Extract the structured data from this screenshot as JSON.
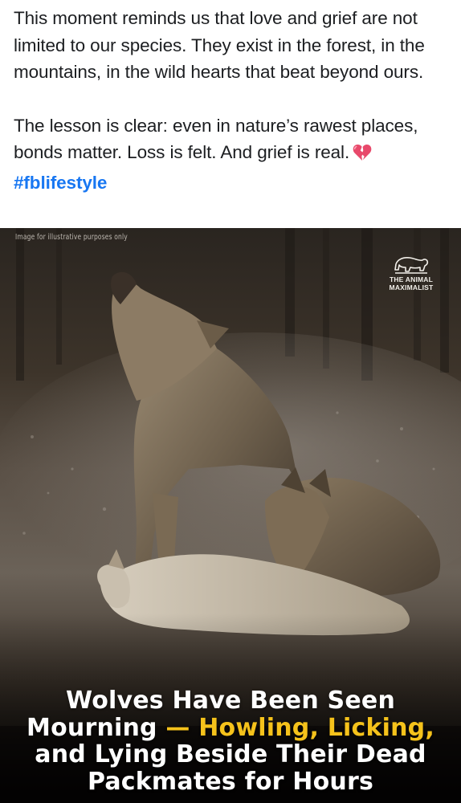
{
  "post": {
    "paragraph_1": "This moment reminds us that love and grief are not limited to our species. They exist in the forest, in the mountains, in the wild hearts that beat beyond ours.",
    "paragraph_2": "The lesson is clear: even in nature’s rawest places, bonds matter. Loss is felt. And grief is real.",
    "emoji": "broken-heart-emoji",
    "hashtag": "#fblifestyle",
    "hashtag_color": "#1877f2"
  },
  "image": {
    "disclaimer": "Image for illustrative purposes only",
    "watermark_line_1": "THE ANIMAL",
    "watermark_line_2": "MAXIMALIST",
    "watermark_icon": "bear-logo-icon",
    "headline_line_1": "Wolves Have Been Seen",
    "headline_line_2_white": "Mourning",
    "headline_line_2_accent": "— Howling, Licking,",
    "headline_line_3": "and Lying Beside Their Dead",
    "headline_line_4": "Packmates for Hours",
    "accent_color": "#f5c21b"
  }
}
